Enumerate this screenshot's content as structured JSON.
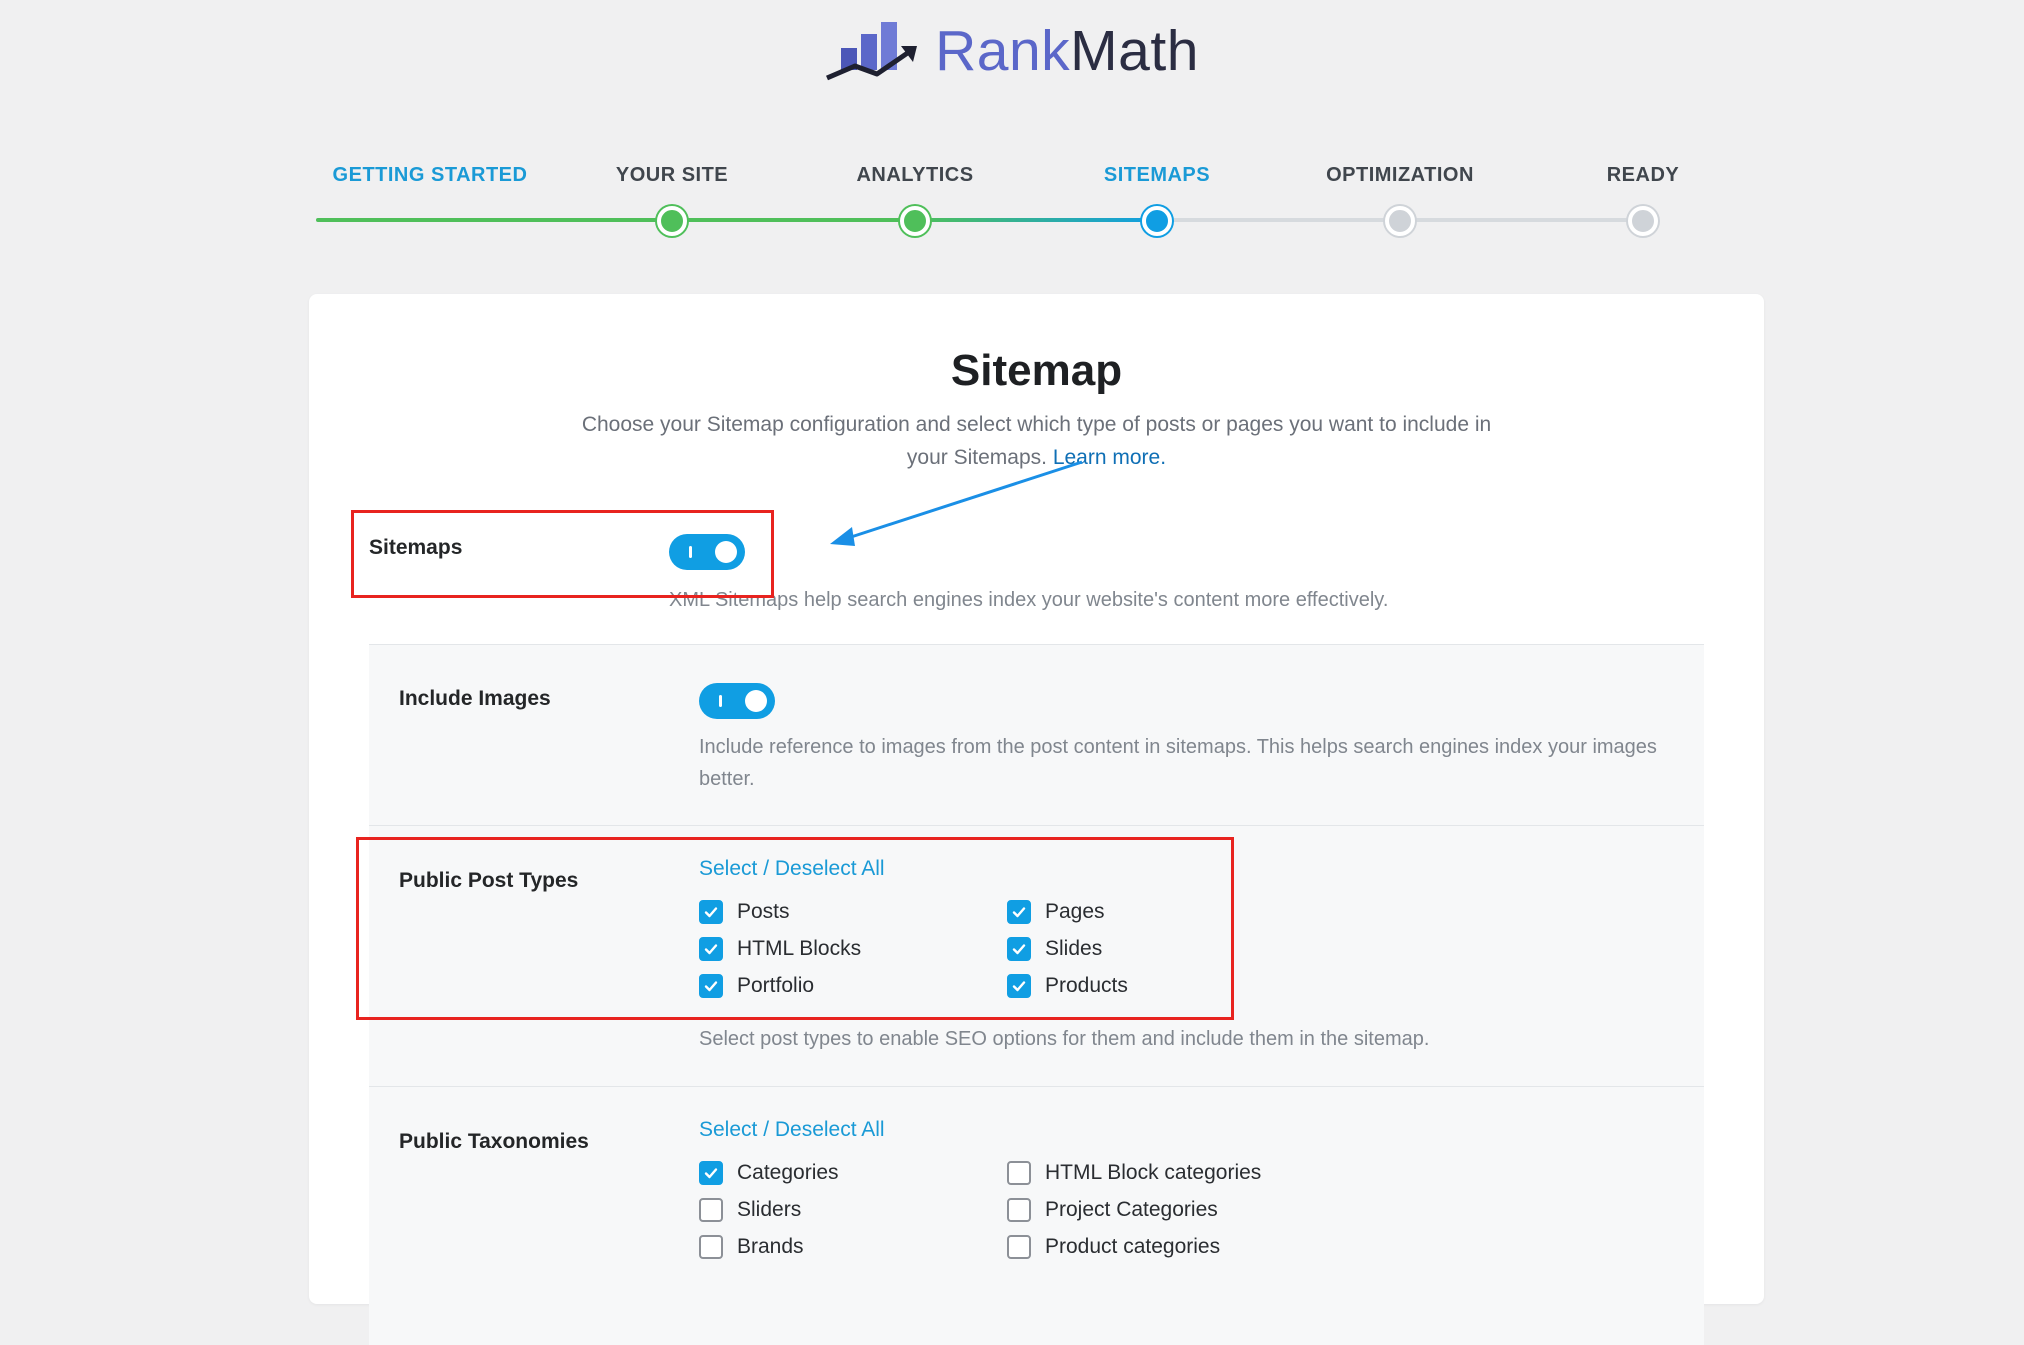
{
  "logo": {
    "rank": "Rank",
    "math": "Math"
  },
  "steps": [
    {
      "label": "GETTING STARTED",
      "state": "done"
    },
    {
      "label": "YOUR SITE",
      "state": "done"
    },
    {
      "label": "ANALYTICS",
      "state": "done"
    },
    {
      "label": "SITEMAPS",
      "state": "current"
    },
    {
      "label": "OPTIMIZATION",
      "state": "todo"
    },
    {
      "label": "READY",
      "state": "todo"
    }
  ],
  "card": {
    "title": "Sitemap",
    "description": "Choose your Sitemap configuration and select which type of posts or pages you want to include in your Sitemaps.",
    "learn_more": "Learn more."
  },
  "sitemaps": {
    "label": "Sitemaps",
    "enabled": true,
    "help": "XML Sitemaps help search engines index your website's content more effectively."
  },
  "include_images": {
    "label": "Include Images",
    "enabled": true,
    "help": "Include reference to images from the post content in sitemaps. This helps search engines index your images better."
  },
  "post_types": {
    "label": "Public Post Types",
    "select_all": "Select / Deselect All",
    "items": [
      {
        "label": "Posts",
        "checked": true
      },
      {
        "label": "Pages",
        "checked": true
      },
      {
        "label": "HTML Blocks",
        "checked": true
      },
      {
        "label": "Slides",
        "checked": true
      },
      {
        "label": "Portfolio",
        "checked": true
      },
      {
        "label": "Products",
        "checked": true
      }
    ],
    "help": "Select post types to enable SEO options for them and include them in the sitemap."
  },
  "taxonomies": {
    "label": "Public Taxonomies",
    "select_all": "Select / Deselect All",
    "items": [
      {
        "label": "Categories",
        "checked": true
      },
      {
        "label": "HTML Block categories",
        "checked": false
      },
      {
        "label": "Sliders",
        "checked": false
      },
      {
        "label": "Project Categories",
        "checked": false
      },
      {
        "label": "Brands",
        "checked": false
      },
      {
        "label": "Product categories",
        "checked": false
      }
    ]
  },
  "colors": {
    "accent": "#109ee3",
    "done": "#4fbf5a",
    "annotation": "#e8231f"
  }
}
